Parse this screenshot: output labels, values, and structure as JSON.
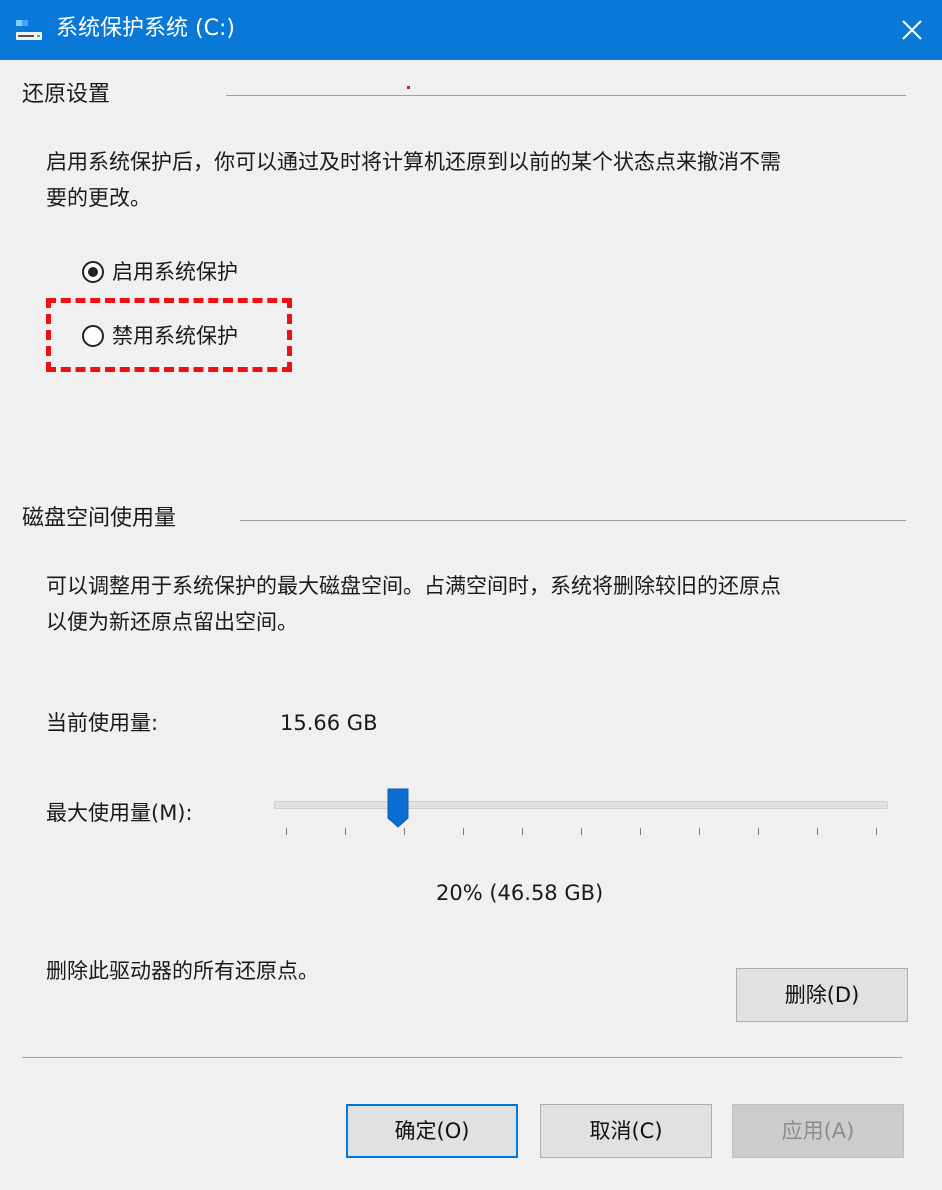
{
  "window": {
    "title": "系统保护系统 (C:)",
    "icon": "drive-icon",
    "close_icon": "close-icon",
    "accent": "#0a78d7"
  },
  "restore": {
    "heading": "还原设置",
    "description_line1": "启用系统保护后，你可以通过及时将计算机还原到以前的某个状态点来撤消不需",
    "description_line2": "要的更改。",
    "options": [
      {
        "label": "启用系统保护",
        "selected": true
      },
      {
        "label": "禁用系统保护",
        "selected": false
      }
    ],
    "highlight_color": "#e11111"
  },
  "disk": {
    "heading": "磁盘空间使用量",
    "description_line1": "可以调整用于系统保护的最大磁盘空间。占满空间时，系统将删除较旧的还原点",
    "description_line2": "以便为新还原点留出空间。",
    "current_usage_label": "当前使用量:",
    "current_usage_value": "15.66 GB",
    "max_usage_label": "最大使用量(M):",
    "max_usage_percent": 20,
    "max_usage_readout": "20% (46.58 GB)",
    "delete_text": "删除此驱动器的所有还原点。",
    "delete_button": "删除(D)"
  },
  "footer": {
    "ok": "确定(O)",
    "cancel": "取消(C)",
    "apply": "应用(A)"
  }
}
